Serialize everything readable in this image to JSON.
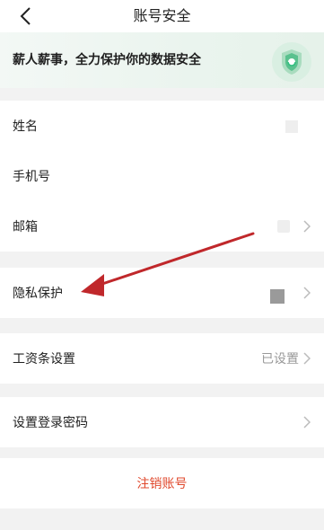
{
  "header": {
    "title": "账号安全",
    "back_icon": "chevron-left-icon"
  },
  "banner": {
    "text": "薪人薪事，全力保护你的数据安全",
    "icon": "shield-icon",
    "accent": "#2fbf7f"
  },
  "group1": {
    "name_label": "姓名",
    "phone_label": "手机号",
    "email_label": "邮箱"
  },
  "privacy": {
    "label": "隐私保护"
  },
  "salary": {
    "label": "工资条设置",
    "value": "已设置"
  },
  "password": {
    "label": "设置登录密码"
  },
  "logout": {
    "label": "注销账号",
    "color": "#e0482c"
  },
  "annotation": {
    "arrow_color": "#c0282b"
  }
}
